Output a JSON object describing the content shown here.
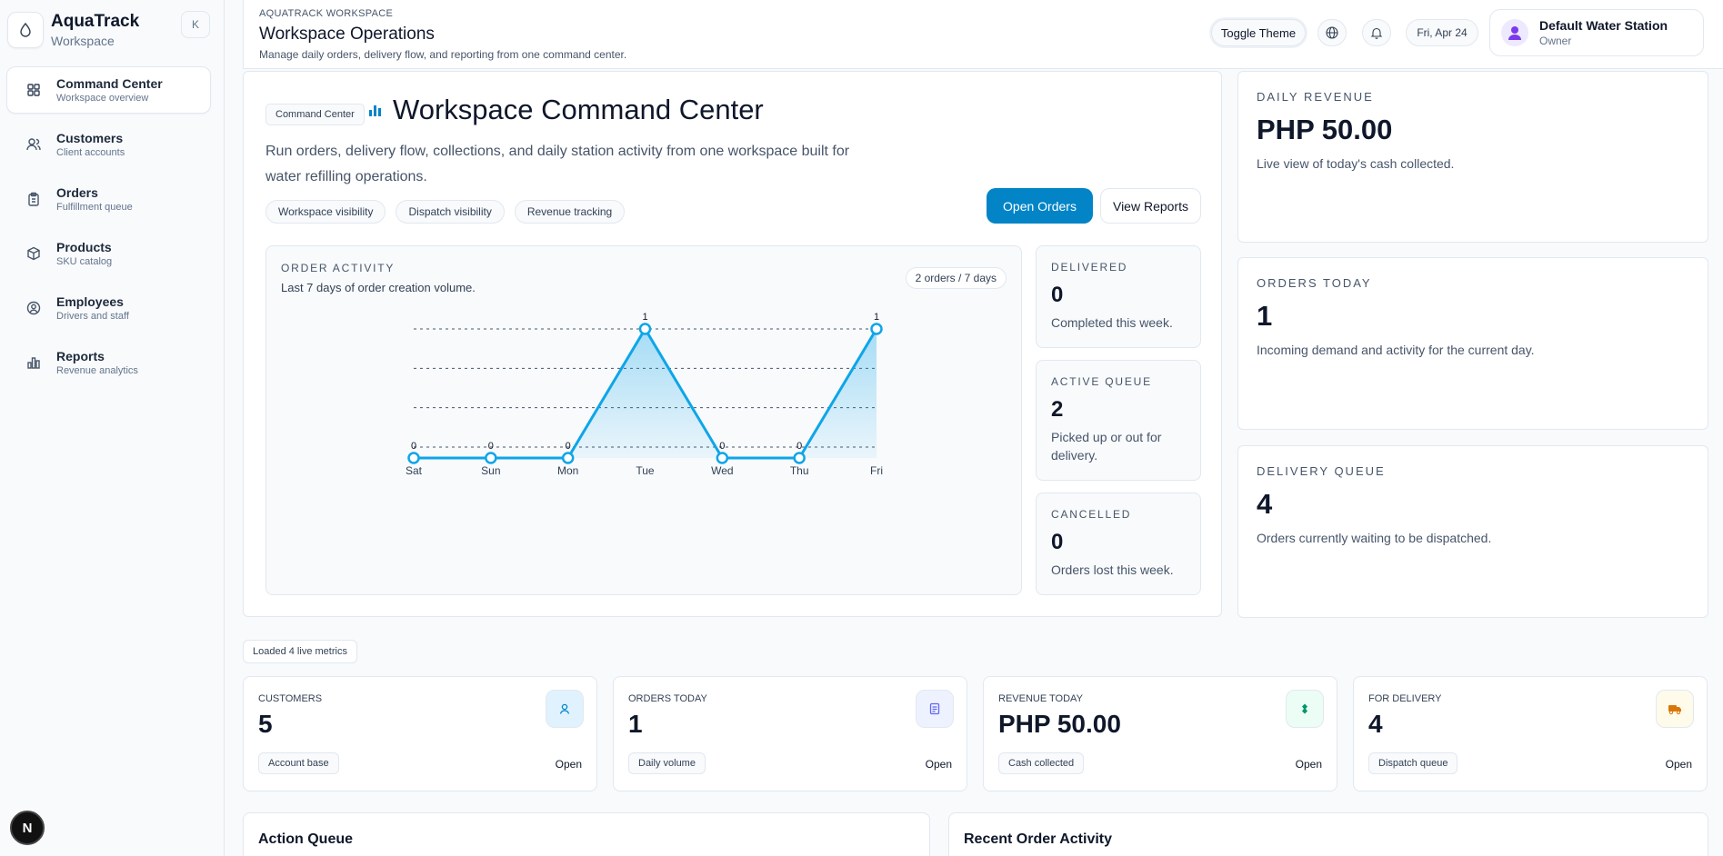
{
  "sidebar": {
    "brand_name": "AquaTrack",
    "brand_sub": "Workspace",
    "collapse_label": "K",
    "items": [
      {
        "label": "Command Center",
        "sub": "Workspace overview",
        "icon": "grid-icon",
        "active": true
      },
      {
        "label": "Customers",
        "sub": "Client accounts",
        "icon": "users-icon"
      },
      {
        "label": "Orders",
        "sub": "Fulfillment queue",
        "icon": "clipboard-icon"
      },
      {
        "label": "Products",
        "sub": "SKU catalog",
        "icon": "box-icon"
      },
      {
        "label": "Employees",
        "sub": "Drivers and staff",
        "icon": "user-circle-icon"
      },
      {
        "label": "Reports",
        "sub": "Revenue analytics",
        "icon": "bar-chart-icon"
      }
    ],
    "avatar_letter": "N"
  },
  "header": {
    "eyebrow": "AQUATRACK WORKSPACE",
    "title": "Workspace Operations",
    "description": "Manage daily orders, delivery flow, and reporting from one command center.",
    "toggle_theme": "Toggle Theme",
    "date": "Fri, Apr 24",
    "station_name": "Default Water Station",
    "station_role": "Owner"
  },
  "hero": {
    "tag": "Command Center",
    "title": "Workspace Command Center",
    "description": "Run orders, delivery flow, collections, and daily station activity from one workspace built for water refilling operations.",
    "chips": [
      "Workspace visibility",
      "Dispatch visibility",
      "Revenue tracking"
    ],
    "primary_button": "Open Orders",
    "secondary_button": "View Reports"
  },
  "chart_panel": {
    "eyebrow": "ORDER ACTIVITY",
    "subtitle": "Last 7 days of order creation volume.",
    "badge": "2 orders / 7 days"
  },
  "chart_data": {
    "type": "area",
    "categories": [
      "Sat",
      "Sun",
      "Mon",
      "Tue",
      "Wed",
      "Thu",
      "Fri"
    ],
    "values": [
      0,
      0,
      0,
      1,
      0,
      0,
      1
    ],
    "ylim": [
      0,
      1
    ],
    "grid": true,
    "color": "#0ea5e9"
  },
  "stats": [
    {
      "label": "DELIVERED",
      "value": "0",
      "desc": "Completed this week."
    },
    {
      "label": "ACTIVE QUEUE",
      "value": "2",
      "desc": "Picked up or out for delivery."
    },
    {
      "label": "CANCELLED",
      "value": "0",
      "desc": "Orders lost this week."
    }
  ],
  "side_cards": [
    {
      "label": "DAILY REVENUE",
      "value": "PHP 50.00",
      "desc": "Live view of today's cash collected."
    },
    {
      "label": "ORDERS TODAY",
      "value": "1",
      "desc": "Incoming demand and activity for the current day."
    },
    {
      "label": "DELIVERY QUEUE",
      "value": "4",
      "desc": "Orders currently waiting to be dispatched."
    }
  ],
  "loaded_chip": "Loaded 4 live metrics",
  "metrics": [
    {
      "label": "CUSTOMERS",
      "value": "5",
      "chip": "Account base",
      "open": "Open",
      "icon": "user-icon",
      "color": "#0284c7",
      "bg": "#e0f2fe"
    },
    {
      "label": "ORDERS TODAY",
      "value": "1",
      "chip": "Daily volume",
      "open": "Open",
      "icon": "document-icon",
      "color": "#6366f1",
      "bg": "#eef2ff"
    },
    {
      "label": "REVENUE TODAY",
      "value": "PHP 50.00",
      "chip": "Cash collected",
      "open": "Open",
      "icon": "money-icon",
      "color": "#059669",
      "bg": "#ecfdf5"
    },
    {
      "label": "FOR DELIVERY",
      "value": "4",
      "chip": "Dispatch queue",
      "open": "Open",
      "icon": "truck-icon",
      "color": "#d97706",
      "bg": "#fffbeb"
    }
  ],
  "bottom": {
    "action_queue": "Action Queue",
    "recent_activity": "Recent Order Activity"
  }
}
